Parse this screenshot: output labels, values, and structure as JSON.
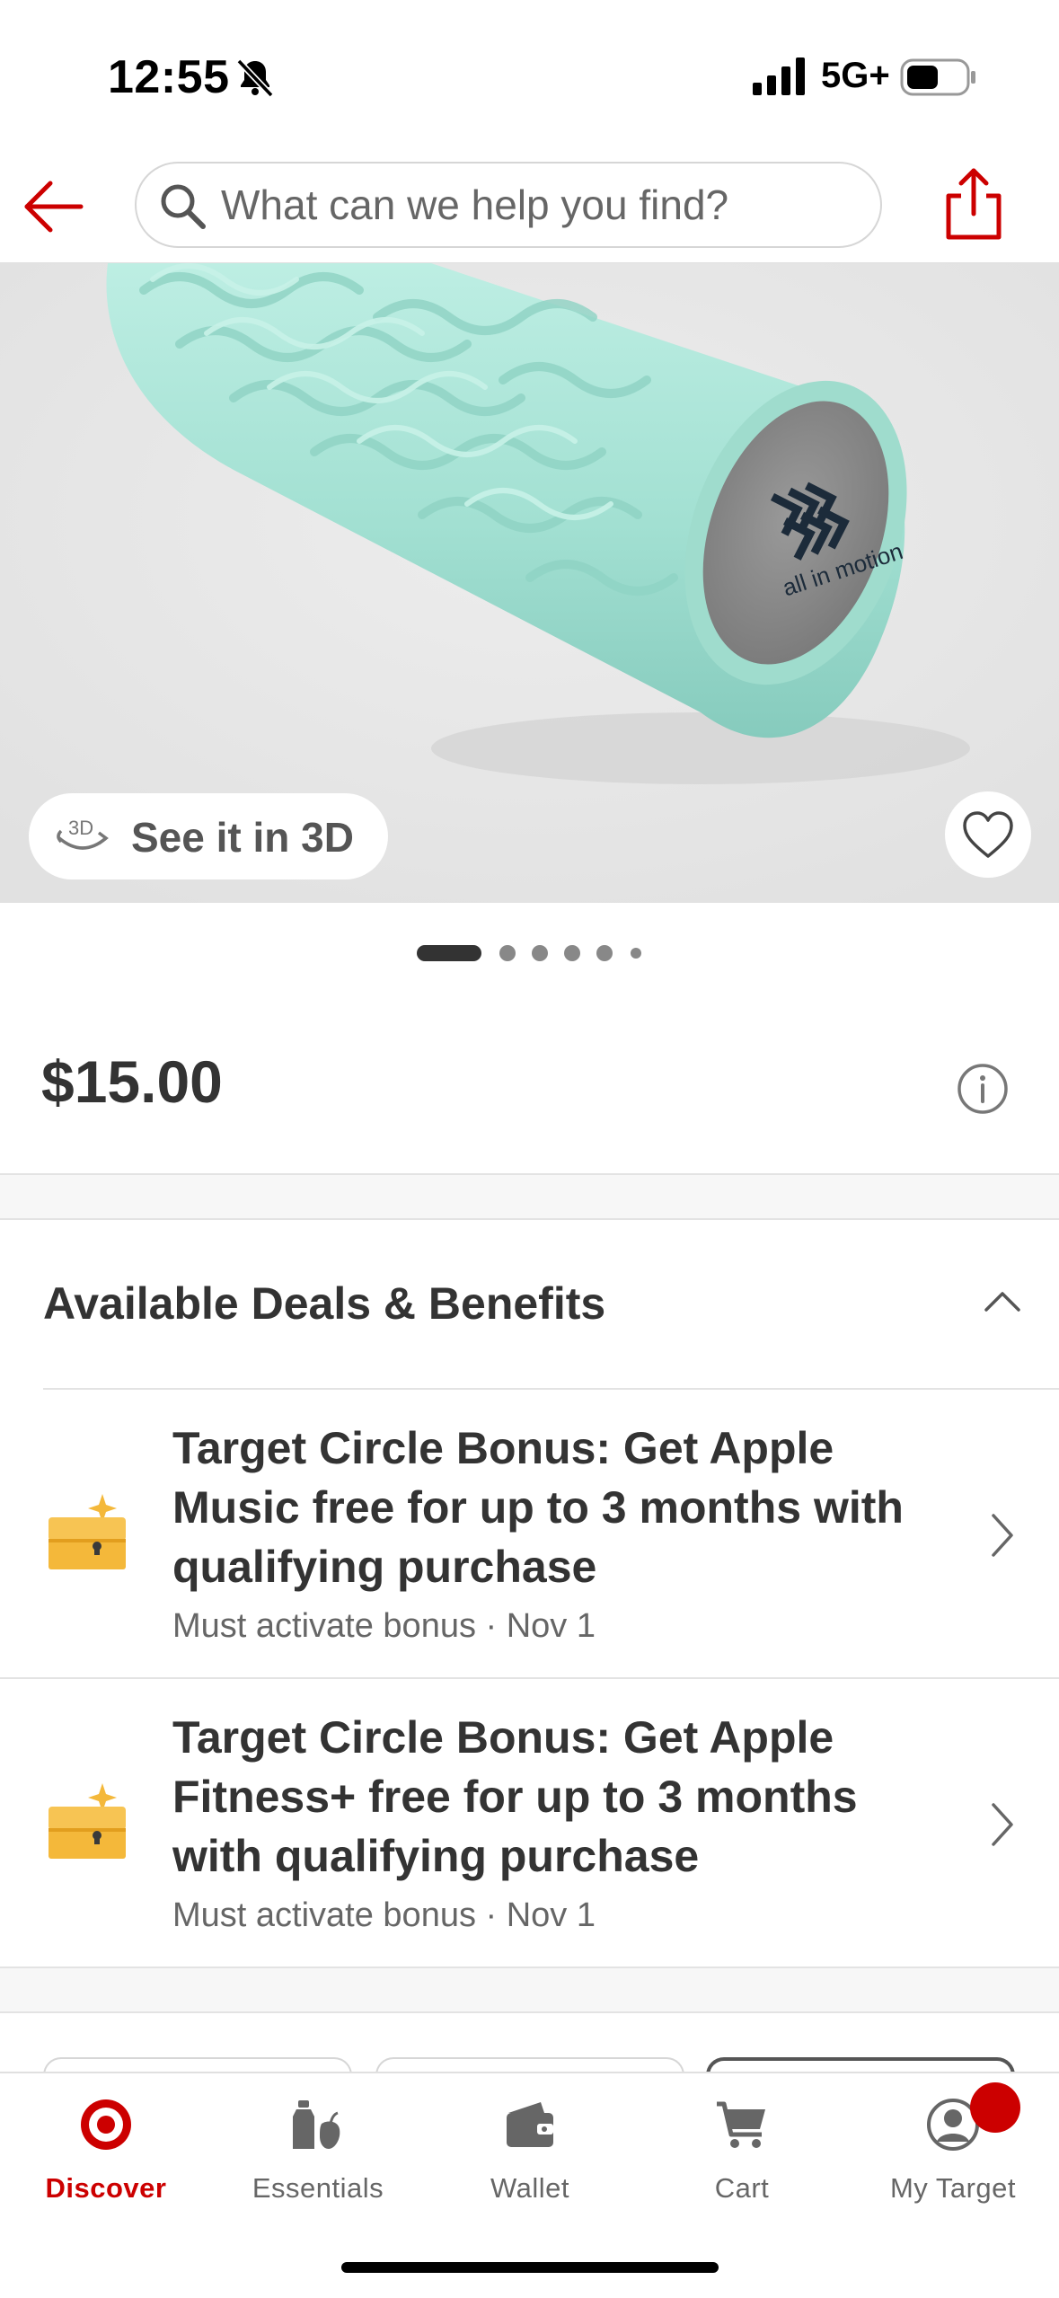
{
  "status_bar": {
    "time": "12:55",
    "network": "5G+",
    "icons": [
      "bell-muted-icon",
      "signal-bars-icon",
      "battery-icon"
    ]
  },
  "header": {
    "search_placeholder": "What can we help you find?",
    "icons": [
      "back-arrow-icon",
      "search-icon",
      "share-icon"
    ],
    "accent_color": "#cc0000"
  },
  "product_image": {
    "brand_mark_text": "all in motion",
    "see_3d_badge": "3D",
    "see_3d_label": "See it in 3D",
    "carousel": {
      "current": 1,
      "total": 6
    }
  },
  "price": "$15.00",
  "deals": {
    "title": "Available Deals & Benefits",
    "items": [
      {
        "title": "Target Circle Bonus: Get Apple Music free for up to 3 months with qualifying purchase",
        "subtitle": "Must activate bonus · Nov 1",
        "icon": "treasure-chest-icon"
      },
      {
        "title": "Target Circle Bonus: Get Apple Fitness+ free for up to 3 months with qualifying purchase",
        "subtitle": "Must activate bonus · Nov 1",
        "icon": "treasure-chest-icon"
      }
    ]
  },
  "tab_bar": {
    "active": "Discover",
    "items": [
      {
        "label": "Discover",
        "icon": "target-logo-icon"
      },
      {
        "label": "Essentials",
        "icon": "essentials-icon"
      },
      {
        "label": "Wallet",
        "icon": "wallet-icon"
      },
      {
        "label": "Cart",
        "icon": "cart-icon"
      },
      {
        "label": "My Target",
        "icon": "account-icon"
      }
    ]
  },
  "colors": {
    "brand_red": "#cc0000",
    "mint_roller": "#a7e3d6",
    "deal_icon_gold": "#f4b83a"
  }
}
